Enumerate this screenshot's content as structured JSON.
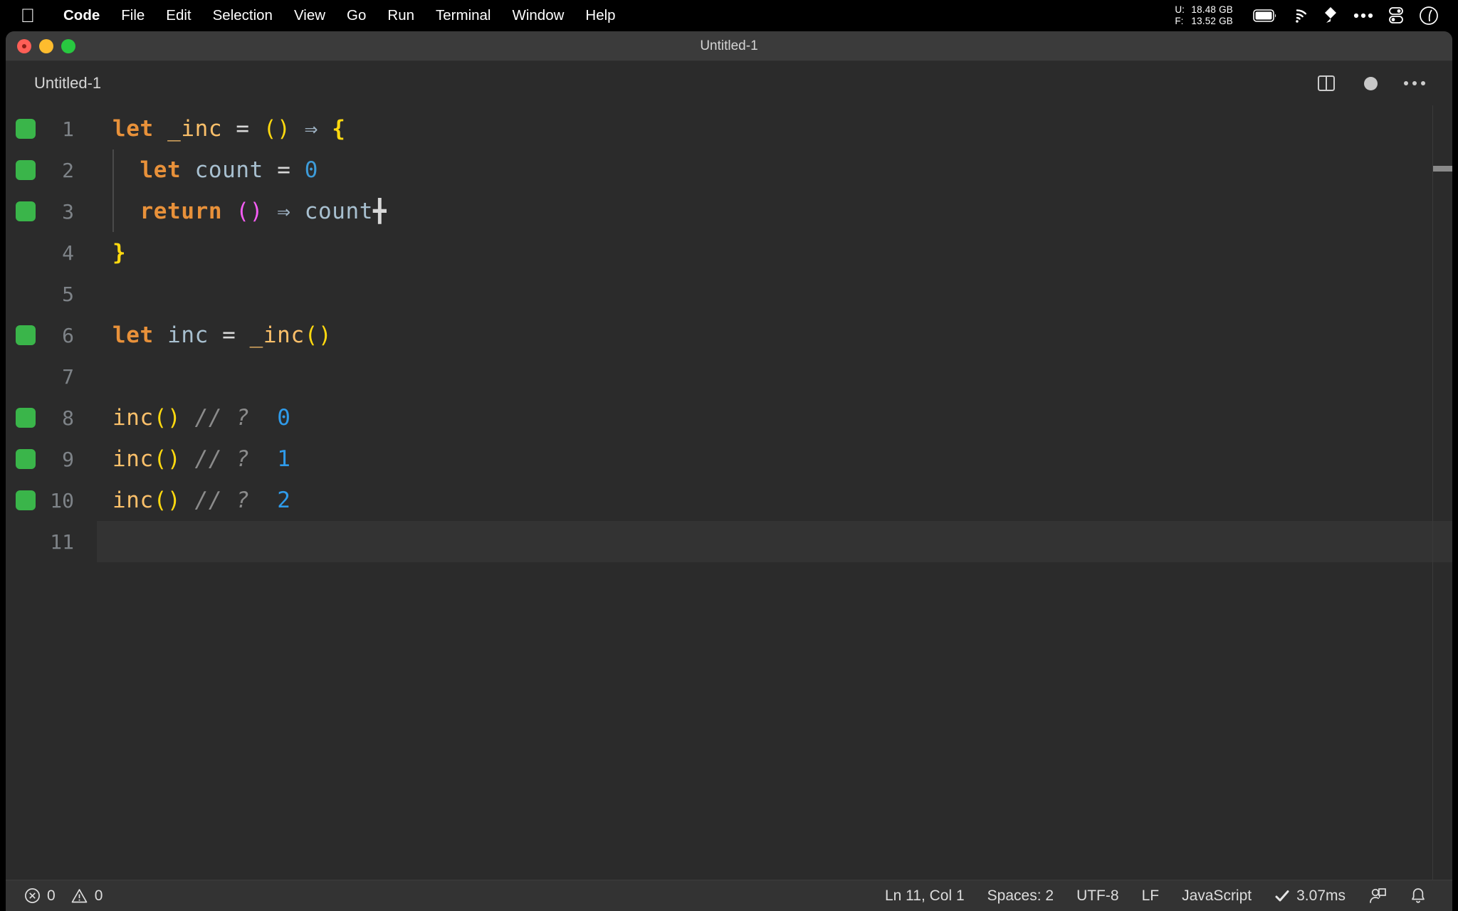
{
  "menubar": {
    "apple_icon": "apple-logo-icon",
    "items": [
      {
        "label": "Code",
        "bold": true
      },
      {
        "label": "File",
        "bold": false
      },
      {
        "label": "Edit",
        "bold": false
      },
      {
        "label": "Selection",
        "bold": false
      },
      {
        "label": "View",
        "bold": false
      },
      {
        "label": "Go",
        "bold": false
      },
      {
        "label": "Run",
        "bold": false
      },
      {
        "label": "Terminal",
        "bold": false
      },
      {
        "label": "Window",
        "bold": false
      },
      {
        "label": "Help",
        "bold": false
      }
    ],
    "memory": {
      "used_label": "U:",
      "used_value": "18.48 GB",
      "free_label": "F:",
      "free_value": "13.52 GB"
    },
    "tray_icons": [
      "battery-icon",
      "wifi-icon",
      "dropbox-icon",
      "ellipsis-icon",
      "control-center-icon",
      "siri-icon"
    ]
  },
  "window": {
    "title": "Untitled-1",
    "traffic_lights": [
      "close-button",
      "minimize-button",
      "maximize-button"
    ]
  },
  "tabbar": {
    "tab_label": "Untitled-1",
    "actions": [
      "split-editor-icon",
      "unsaved-dot-icon",
      "more-actions-icon"
    ]
  },
  "editor": {
    "active_line": 11,
    "lines": [
      {
        "num": "1",
        "breakpoint": true,
        "indent_guide": false,
        "tokens": [
          {
            "t": "let",
            "c": "t-kw"
          },
          {
            "t": " ",
            "c": "t-op"
          },
          {
            "t": "_inc",
            "c": "t-fn"
          },
          {
            "t": " ",
            "c": "t-op"
          },
          {
            "t": "=",
            "c": "t-op"
          },
          {
            "t": " ",
            "c": "t-op"
          },
          {
            "t": "()",
            "c": "t-paren-y"
          },
          {
            "t": " ",
            "c": "t-op"
          },
          {
            "t": "⇒",
            "c": "t-arrow"
          },
          {
            "t": " ",
            "c": "t-op"
          },
          {
            "t": "{",
            "c": "t-brace-y"
          }
        ]
      },
      {
        "num": "2",
        "breakpoint": true,
        "indent_guide": true,
        "tokens": [
          {
            "t": "  ",
            "c": "t-op"
          },
          {
            "t": "let",
            "c": "t-kw"
          },
          {
            "t": " ",
            "c": "t-op"
          },
          {
            "t": "count",
            "c": "t-var"
          },
          {
            "t": " ",
            "c": "t-op"
          },
          {
            "t": "=",
            "c": "t-op"
          },
          {
            "t": " ",
            "c": "t-op"
          },
          {
            "t": "0",
            "c": "t-num"
          }
        ]
      },
      {
        "num": "3",
        "breakpoint": true,
        "indent_guide": true,
        "tokens": [
          {
            "t": "  ",
            "c": "t-op"
          },
          {
            "t": "return",
            "c": "t-kw"
          },
          {
            "t": " ",
            "c": "t-op"
          },
          {
            "t": "()",
            "c": "t-paren-m"
          },
          {
            "t": " ",
            "c": "t-op"
          },
          {
            "t": "⇒",
            "c": "t-arrow"
          },
          {
            "t": " ",
            "c": "t-op"
          },
          {
            "t": "count",
            "c": "t-var"
          },
          {
            "t": "╋",
            "c": "t-op"
          }
        ]
      },
      {
        "num": "4",
        "breakpoint": false,
        "indent_guide": false,
        "tokens": [
          {
            "t": "}",
            "c": "t-brace-y"
          }
        ]
      },
      {
        "num": "5",
        "breakpoint": false,
        "indent_guide": false,
        "tokens": []
      },
      {
        "num": "6",
        "breakpoint": true,
        "indent_guide": false,
        "tokens": [
          {
            "t": "let",
            "c": "t-kw"
          },
          {
            "t": " ",
            "c": "t-op"
          },
          {
            "t": "inc",
            "c": "t-var"
          },
          {
            "t": " ",
            "c": "t-op"
          },
          {
            "t": "=",
            "c": "t-op"
          },
          {
            "t": " ",
            "c": "t-op"
          },
          {
            "t": "_inc",
            "c": "t-fn"
          },
          {
            "t": "()",
            "c": "t-paren-y"
          }
        ]
      },
      {
        "num": "7",
        "breakpoint": false,
        "indent_guide": false,
        "tokens": []
      },
      {
        "num": "8",
        "breakpoint": true,
        "indent_guide": false,
        "tokens": [
          {
            "t": "inc",
            "c": "t-fn"
          },
          {
            "t": "()",
            "c": "t-paren-y"
          },
          {
            "t": " ",
            "c": "t-op"
          },
          {
            "t": "// ?",
            "c": "t-comment"
          },
          {
            "t": "  ",
            "c": "t-op"
          },
          {
            "t": "0",
            "c": "t-num2"
          }
        ]
      },
      {
        "num": "9",
        "breakpoint": true,
        "indent_guide": false,
        "tokens": [
          {
            "t": "inc",
            "c": "t-fn"
          },
          {
            "t": "()",
            "c": "t-paren-y"
          },
          {
            "t": " ",
            "c": "t-op"
          },
          {
            "t": "// ?",
            "c": "t-comment"
          },
          {
            "t": "  ",
            "c": "t-op"
          },
          {
            "t": "1",
            "c": "t-num2"
          }
        ]
      },
      {
        "num": "10",
        "breakpoint": true,
        "indent_guide": false,
        "tokens": [
          {
            "t": "inc",
            "c": "t-fn"
          },
          {
            "t": "()",
            "c": "t-paren-y"
          },
          {
            "t": " ",
            "c": "t-op"
          },
          {
            "t": "// ?",
            "c": "t-comment"
          },
          {
            "t": "  ",
            "c": "t-op"
          },
          {
            "t": "2",
            "c": "t-num2"
          }
        ]
      },
      {
        "num": "11",
        "breakpoint": false,
        "indent_guide": false,
        "tokens": []
      }
    ]
  },
  "statusbar": {
    "errors_icon": "error-circle-icon",
    "errors_count": "0",
    "warnings_icon": "warning-triangle-icon",
    "warnings_count": "0",
    "cursor_position": "Ln 11, Col 1",
    "indentation": "Spaces: 2",
    "encoding": "UTF-8",
    "eol": "LF",
    "language": "JavaScript",
    "run_status_icon": "checkmark-icon",
    "run_time": "3.07ms",
    "account_icon": "account-icon",
    "bell_icon": "bell-icon"
  },
  "colors": {
    "editor_bg": "#2b2b2b",
    "active_line_bg": "#333333",
    "titlebar_bg": "#3b3b3b",
    "statusbar_bg": "#333333",
    "breakpoint_green": "#3ab54a",
    "keyword_orange": "#e8913a",
    "function_tan": "#fcc06a",
    "variable_blue": "#a8c0d0",
    "number_blue": "#2f9bea",
    "paren_yellow": "#ffd90f",
    "paren_magenta": "#f45df4",
    "comment_gray": "#8b8b8b"
  }
}
